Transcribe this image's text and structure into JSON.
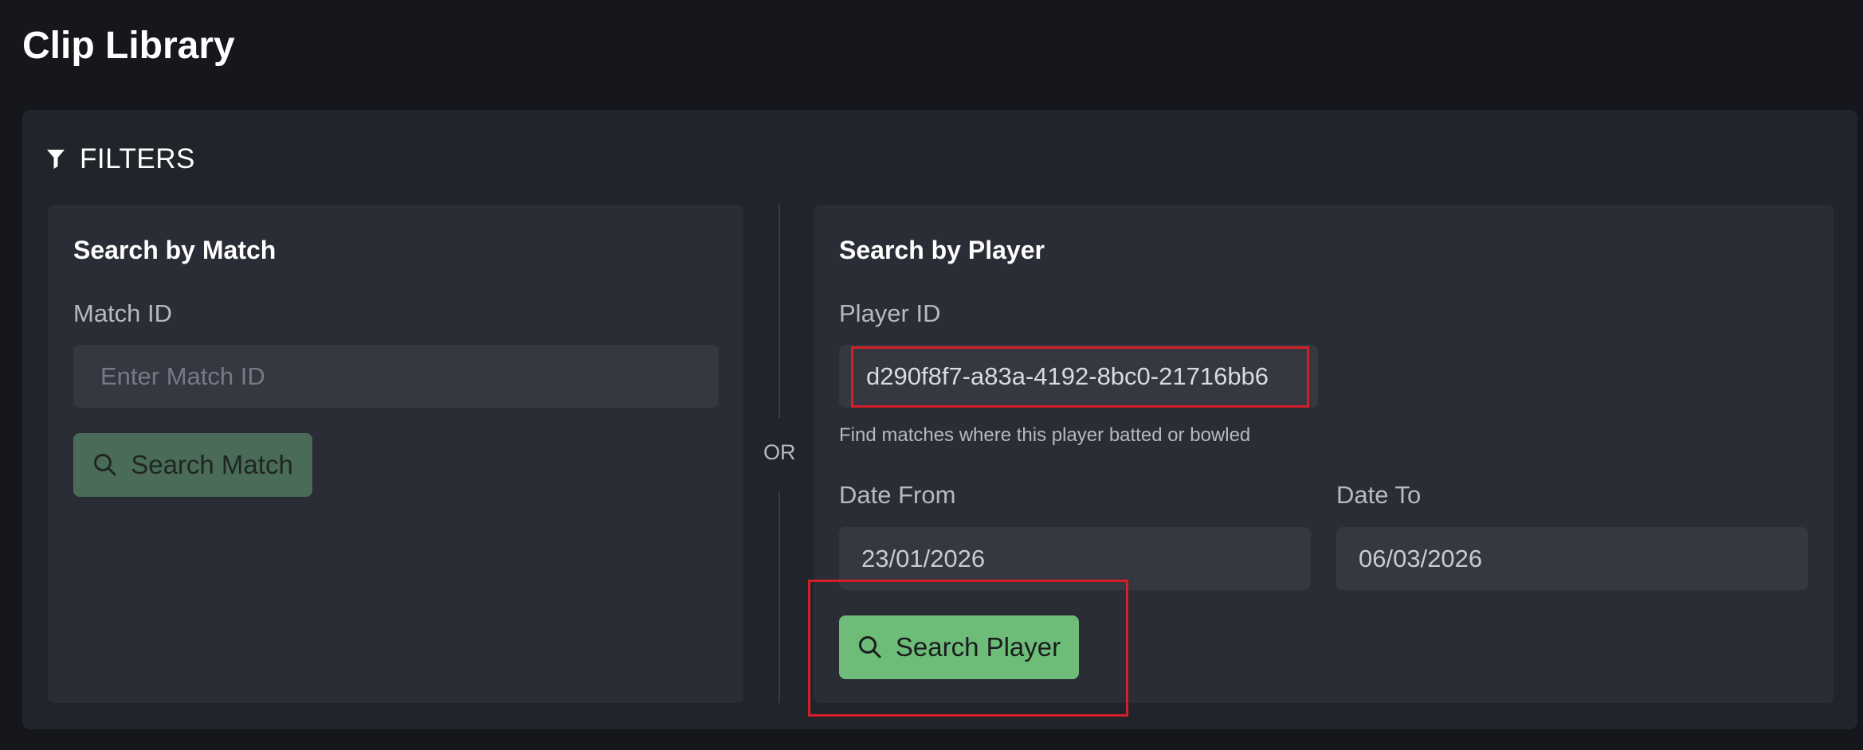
{
  "page": {
    "title": "Clip Library"
  },
  "filters": {
    "header_label": "FILTERS",
    "header_icon": "filter-icon",
    "or_label": "OR"
  },
  "match_search": {
    "title": "Search by Match",
    "match_id_label": "Match ID",
    "match_id_placeholder": "Enter Match ID",
    "match_id_value": "",
    "button_label": "Search Match",
    "button_icon": "search-icon"
  },
  "player_search": {
    "title": "Search by Player",
    "player_id_label": "Player ID",
    "player_id_value": "d290f8f7-a83a-4192-8bc0-21716bb6",
    "helper_text": "Find matches where this player batted or bowled",
    "date_from_label": "Date From",
    "date_from_value": "23/01/2026",
    "date_to_label": "Date To",
    "date_to_value": "06/03/2026",
    "button_label": "Search Player",
    "button_icon": "search-icon"
  },
  "colors": {
    "background": "#16171c",
    "card": "#22242c",
    "panel": "#2b2d36",
    "input": "#353741",
    "primary_button": "#6dbd78",
    "disabled_button": "#4a6b57",
    "highlight": "#d41f27"
  }
}
